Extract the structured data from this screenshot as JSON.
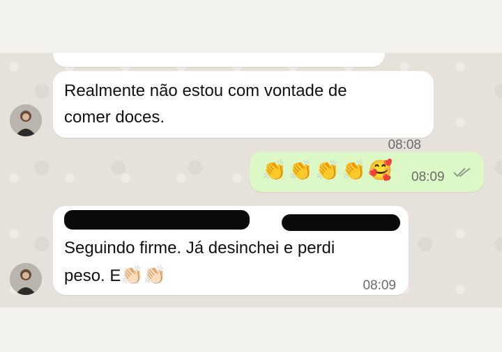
{
  "messages": [
    {
      "text": "",
      "time": "08:08"
    },
    {
      "text_line1": "Realmente não estou com vontade de",
      "text_line2": "comer doces.",
      "time": "08:08"
    },
    {
      "emojis": [
        "👏",
        "👏",
        "👏",
        "👏",
        "🥰"
      ],
      "time": "08:09",
      "status": "read"
    },
    {
      "text_line1": "Seguindo firme.  Já desinchei e perdi",
      "text_line2_prefix": "peso.  E",
      "emojis": [
        "👏🏻",
        "👏🏻"
      ],
      "time": "08:09"
    }
  ]
}
